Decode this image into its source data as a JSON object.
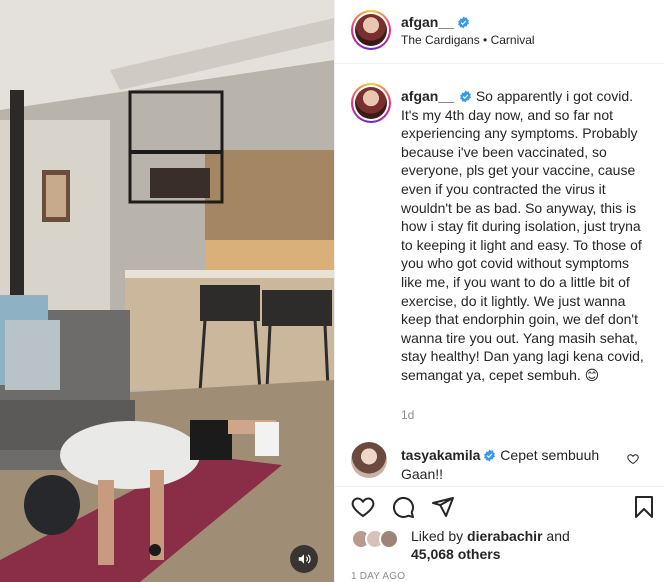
{
  "post": {
    "username": "afgan__",
    "audio": "The Cardigans • Carnival",
    "caption": "So apparently i got covid. It's my 4th day now, and so far not experiencing any symptoms. Probably because i've been vaccinated, so everyone, pls get your vaccine, cause even if you contracted the virus it wouldn't be as bad. So anyway, this is how i stay fit during isolation, just tryna to keeping it light and easy. To those of you who got covid without symptoms like me, if you want to do a little bit of exercise, do it lightly. We just wanna keep that endorphin goin, we def don't wanna tire you out. Yang masih sehat, stay healthy! Dan yang lagi kena covid, semangat ya, cepet sembuh. 😊",
    "time_ago": "1d"
  },
  "comment": {
    "username": "tasyakamila",
    "text": "Cepet sembuuh Gaan!!"
  },
  "likes": {
    "prefix": "Liked by",
    "by": "dierabachir",
    "and": "and",
    "count": "45,068 others"
  },
  "date": "1 DAY AGO",
  "icons": {
    "like": "heart-icon",
    "comment": "comment-icon",
    "share": "share-icon",
    "save": "bookmark-icon",
    "sound": "speaker-icon",
    "verified": "verified-badge-icon"
  },
  "colors": {
    "verified": "#3897f0",
    "secondary_text": "#8e8e8e",
    "divider": "#efefef"
  }
}
